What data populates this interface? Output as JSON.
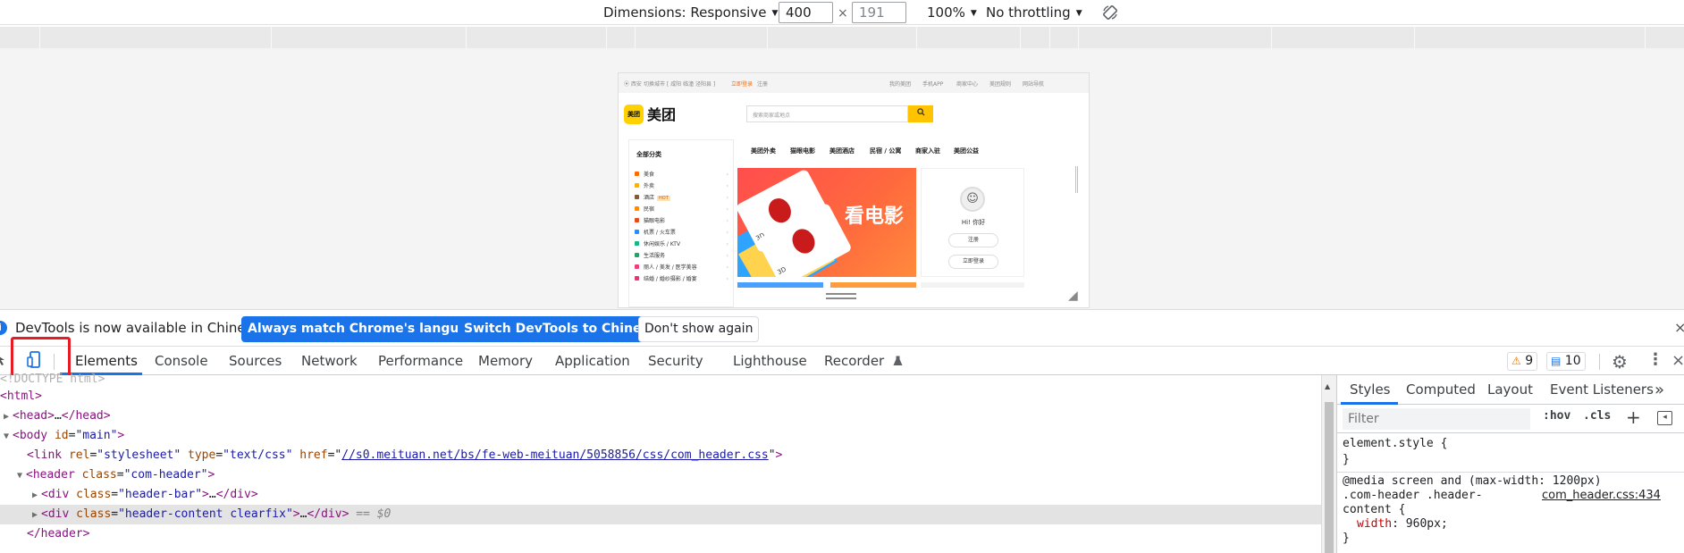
{
  "device_toolbar": {
    "dimensions_label": "Dimensions: Responsive",
    "width_value": "400",
    "height_value": "191",
    "times": "×",
    "zoom": "100%",
    "throttling": "No throttling",
    "caret": "▼",
    "rotate_icon": "rotate-icon"
  },
  "emulated_page": {
    "topbar": {
      "location": "西安",
      "switch_city": "切换城市 [ 咸阳 临潼 泾阳县 ]",
      "login": "立即登录",
      "register": "注册",
      "links": [
        "我的美团",
        "手机APP",
        "商家中心",
        "美团规则",
        "网站导航"
      ]
    },
    "logo_text": "美团",
    "brand": "美团",
    "search_placeholder": "搜索商家或地点",
    "search_icon": "search-icon",
    "category_title": "全部分类",
    "categories": [
      {
        "label": "美食",
        "color": "#ff6a00"
      },
      {
        "label": "外卖",
        "color": "#ffb000"
      },
      {
        "label": "酒店",
        "color": "#7d5c3c",
        "hot": "HOT"
      },
      {
        "label": "民宿",
        "color": "#ff8a00"
      },
      {
        "label": "猫眼电影",
        "color": "#e64a19"
      },
      {
        "label": "机票 / 火车票",
        "color": "#2b8cff"
      },
      {
        "label": "休闲娱乐 / KTV",
        "color": "#12b886"
      },
      {
        "label": "生活服务",
        "color": "#26a269"
      },
      {
        "label": "丽人 / 美发 / 医学美容",
        "color": "#f03e7a"
      },
      {
        "label": "结婚 / 婚纱摄影 / 婚宴",
        "color": "#e5386e"
      }
    ],
    "nav": [
      "美团外卖",
      "猫眼电影",
      "美团酒店",
      "民宿 / 公寓",
      "商家入驻",
      "美团公益"
    ],
    "banner_text": "看电影",
    "banner_3d": "3D",
    "user": {
      "greeting": "Hi! 你好",
      "register": "注册",
      "login": "立即登录"
    }
  },
  "infobar": {
    "message": "DevTools is now available in Chinese!",
    "btn_match": "Always match Chrome's language",
    "btn_switch": "Switch DevTools to Chinese",
    "btn_dismiss": "Don't show again",
    "close": "×"
  },
  "devtools": {
    "tabs": [
      "Elements",
      "Console",
      "Sources",
      "Network",
      "Performance",
      "Memory",
      "Application",
      "Security",
      "Lighthouse",
      "Recorder"
    ],
    "recorder_icon": "flask-icon",
    "warnings": "9",
    "messages": "10",
    "close": "×"
  },
  "elements": {
    "doctype": "<!DOCTYPE html>",
    "lines": {
      "html_open": "<html>",
      "head_tag": "<head>",
      "head_ellipsis": "…",
      "head_close": "</head>",
      "body_open": "<body",
      "body_attr": "id",
      "body_val": "\"main\"",
      "link_tag": "<link",
      "link_rel_attr": "rel",
      "link_rel_val": "\"stylesheet\"",
      "link_type_attr": "type",
      "link_type_val": "\"text/css\"",
      "link_href_attr": "href",
      "link_href_val": "//s0.meituan.net/bs/fe-web-meituan/5058856/css/com_header.css",
      "header_open": "<header",
      "header_attr": "class",
      "header_val": "\"com-header\"",
      "div_tag": "<div",
      "div_attr": "class",
      "div1_val": "\"header-bar\"",
      "div2_val": "\"header-content clearfix\"",
      "ellipsis": "…",
      "div_close": "</div>",
      "eq0": "== $0",
      "header_close": "</header>"
    }
  },
  "styles": {
    "tabs": [
      "Styles",
      "Computed",
      "Layout",
      "Event Listeners"
    ],
    "more": "»",
    "filter_placeholder": "Filter",
    "hov": ":hov",
    "cls": ".cls",
    "new_rule": "+",
    "element_style": "element.style {",
    "close_brace": "}",
    "media": "@media screen and (max-width: 1200px)",
    "selector_1": ".com-header .header-",
    "selector_2": "content {",
    "source": "com_header.css:434",
    "prop": "width",
    "value": "960px;"
  }
}
